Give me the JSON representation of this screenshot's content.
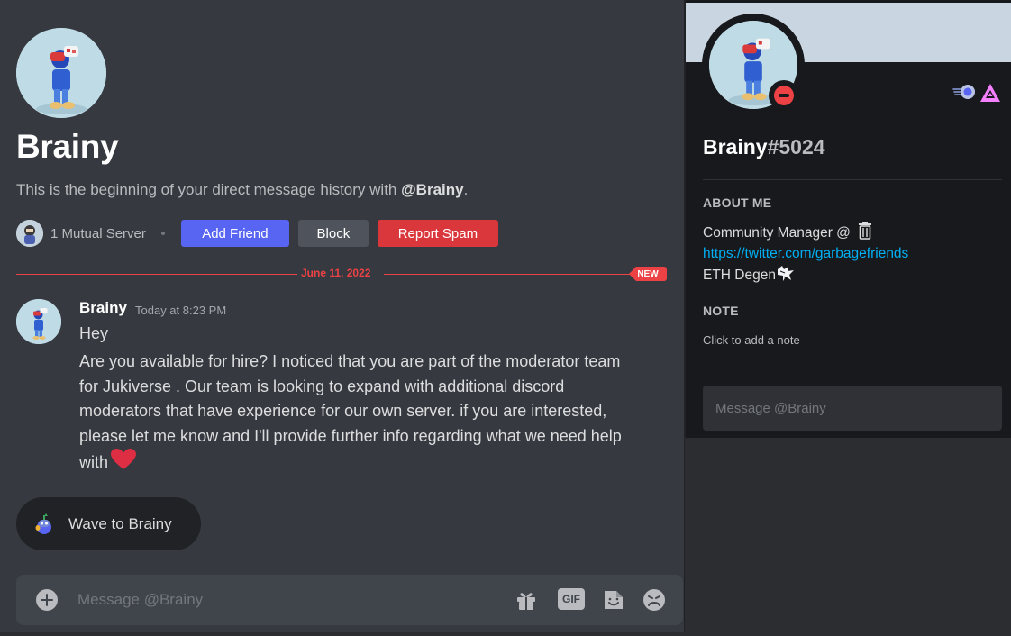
{
  "user": {
    "display_name": "Brainy",
    "username": "Brainy",
    "discriminator": "#5024",
    "status": "do-not-disturb"
  },
  "chat": {
    "intro_prefix": "This is the beginning of your direct message history with ",
    "intro_handle": "@Brainy",
    "intro_suffix": ".",
    "mutual_servers": "1 Mutual Server",
    "add_friend_label": "Add Friend",
    "block_label": "Block",
    "report_label": "Report Spam",
    "date_divider": "June 11, 2022",
    "new_badge": "NEW"
  },
  "message": {
    "author": "Brainy",
    "timestamp": "Today at 8:23 PM",
    "line1": "Hey",
    "body": "Are you available for hire? I noticed that you are part of the moderator team for Jukiverse . Our team is looking to expand with additional discord moderators that have experience for our own server. if you are interested, please let me know and I'll provide further info regarding what we need help with",
    "trailing_emoji": "heart-icon"
  },
  "wave": {
    "label": "Wave to Brainy",
    "icon": "wumpus-icon"
  },
  "composer": {
    "placeholder": "Message @Brainy",
    "gif_label": "GIF",
    "icons": [
      "plus-icon",
      "gift-icon",
      "gif-icon",
      "sticker-icon",
      "emoji-icon"
    ]
  },
  "profile": {
    "about_heading": "ABOUT ME",
    "about_line1": "Community Manager @ ",
    "about_link": "https://twitter.com/garbagefriends",
    "about_line3": "ETH Degen",
    "note_heading": "NOTE",
    "note_placeholder": "Click to add a note",
    "message_placeholder": "Message @Brainy",
    "badges": [
      "hypesquad-icon",
      "nitro-icon"
    ]
  },
  "colors": {
    "blurple": "#5865f2",
    "danger": "#da373c",
    "divider_red": "#ed4245",
    "link": "#00aff4",
    "banner": "#c9d6e2"
  }
}
